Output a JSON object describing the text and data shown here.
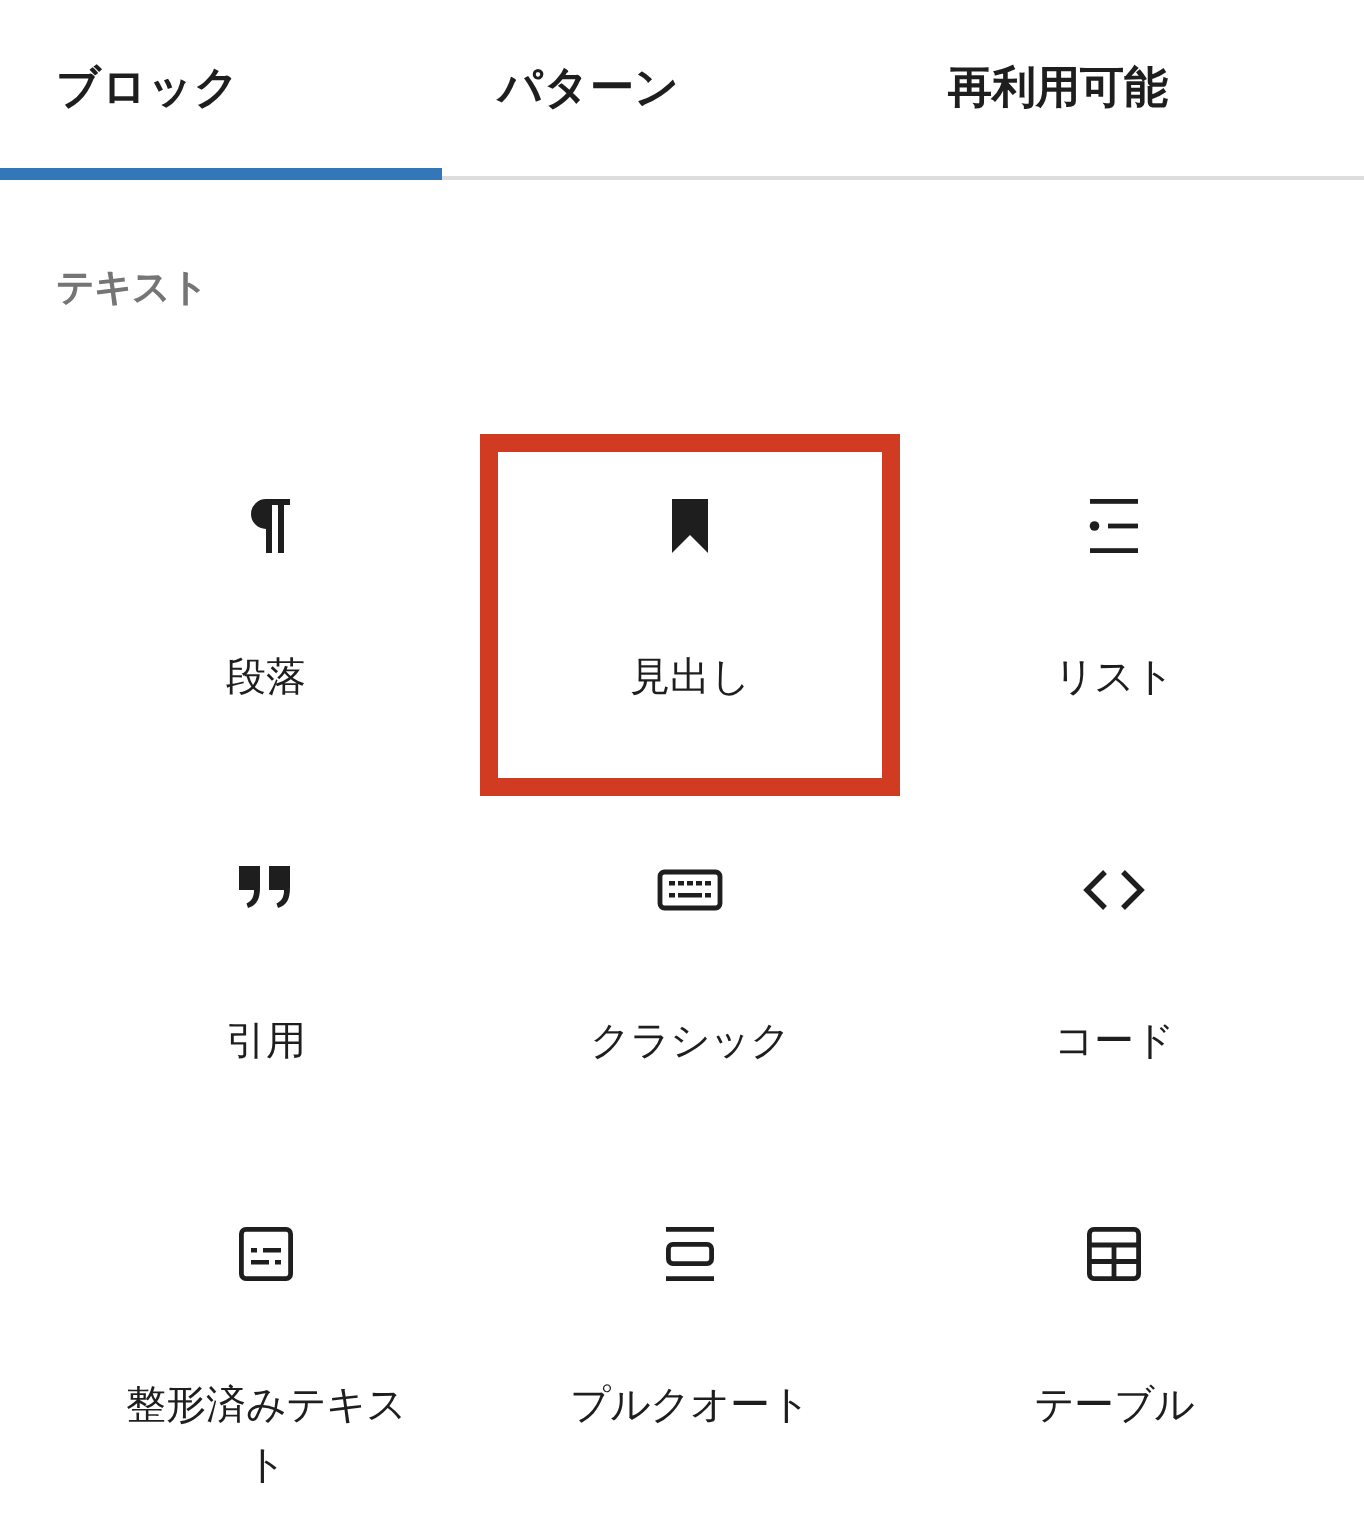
{
  "tabs": [
    {
      "label": "ブロック",
      "selected": true
    },
    {
      "label": "パターン",
      "selected": false
    },
    {
      "label": "再利用可能",
      "selected": false
    }
  ],
  "section": {
    "title": "テキスト"
  },
  "blocks": [
    {
      "label": "段落",
      "kind": "paragraph",
      "highlighted": false
    },
    {
      "label": "見出し",
      "kind": "heading",
      "highlighted": true
    },
    {
      "label": "リスト",
      "kind": "list",
      "highlighted": false
    },
    {
      "label": "引用",
      "kind": "quote",
      "highlighted": false
    },
    {
      "label": "クラシック",
      "kind": "classic",
      "highlighted": false
    },
    {
      "label": "コード",
      "kind": "code",
      "highlighted": false
    },
    {
      "label": "整形済みテキスト",
      "kind": "preformatted",
      "highlighted": false
    },
    {
      "label": "プルクオート",
      "kind": "pullquote",
      "highlighted": false
    },
    {
      "label": "テーブル",
      "kind": "table",
      "highlighted": false
    }
  ]
}
